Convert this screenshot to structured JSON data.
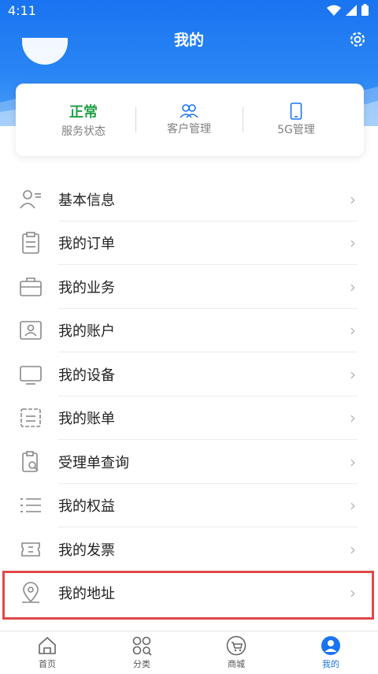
{
  "status_bar": {
    "time": "4:11"
  },
  "header": {
    "title": "我的"
  },
  "card": {
    "service_status_value": "正常",
    "service_status_label": "服务状态",
    "customer_label": "客户管理",
    "fiveg_label": "5G管理"
  },
  "menu": {
    "items": [
      {
        "label": "基本信息",
        "icon": "user-info-icon"
      },
      {
        "label": "我的订单",
        "icon": "clipboard-icon"
      },
      {
        "label": "我的业务",
        "icon": "briefcase-icon"
      },
      {
        "label": "我的账户",
        "icon": "id-card-icon"
      },
      {
        "label": "我的设备",
        "icon": "monitor-icon"
      },
      {
        "label": "我的账单",
        "icon": "bill-icon"
      },
      {
        "label": "受理单查询",
        "icon": "search-doc-icon"
      },
      {
        "label": "我的权益",
        "icon": "list-icon"
      },
      {
        "label": "我的发票",
        "icon": "ticket-icon"
      },
      {
        "label": "我的地址",
        "icon": "location-pin-icon"
      }
    ]
  },
  "tabbar": {
    "home": "首页",
    "category": "分类",
    "mall": "商城",
    "mine": "我的"
  },
  "colors": {
    "primary": "#1a73f0",
    "status_green": "#24a046",
    "highlight_red": "#e04848"
  }
}
